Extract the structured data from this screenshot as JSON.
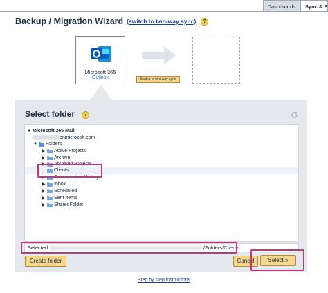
{
  "tabs": [
    {
      "label": "Dashboards",
      "active": false
    },
    {
      "label": "Sync & Ba",
      "active": true
    }
  ],
  "header": {
    "title": "Backup / Migration Wizard",
    "switch_link": "(switch to two-way sync)",
    "help": "?"
  },
  "source": {
    "name": "Microsoft 365",
    "sub": "Outlook",
    "icon": "outlook-icon"
  },
  "switch_button": "Switch to two-way sync",
  "panel": {
    "title": "Select folder",
    "help": "?"
  },
  "tree": {
    "root": "Microsoft 365 Mail",
    "account_suffix": "onmicrosoft.com",
    "items": [
      {
        "label": "Folders",
        "level": 1,
        "toggle": "▼"
      },
      {
        "label": "Active Projects",
        "level": 2,
        "toggle": "▶"
      },
      {
        "label": "Archive",
        "level": 2,
        "toggle": "▶"
      },
      {
        "label": "Archived Projects",
        "level": 2,
        "toggle": "▶"
      },
      {
        "label": "Clients",
        "level": 2,
        "toggle": ""
      },
      {
        "label": "Conversation History",
        "level": 2,
        "toggle": "▶"
      },
      {
        "label": "Inbox",
        "level": 2,
        "toggle": "▶"
      },
      {
        "label": "Scheduled",
        "level": 2,
        "toggle": "▶"
      },
      {
        "label": "Sent Items",
        "level": 2,
        "toggle": "▶"
      },
      {
        "label": "SharedFolder",
        "level": 2,
        "toggle": "▶"
      }
    ]
  },
  "selected": {
    "label": "Selected:",
    "path_visible": "/Folders/Clients"
  },
  "buttons": {
    "create": "Create folder",
    "cancel": "Cancel",
    "select": "Select »"
  },
  "footer": {
    "step_link": "Step by step instructions"
  },
  "colors": {
    "button_bg": "#f7d78f",
    "highlight": "#c2367a",
    "link": "#1a3f8f"
  }
}
